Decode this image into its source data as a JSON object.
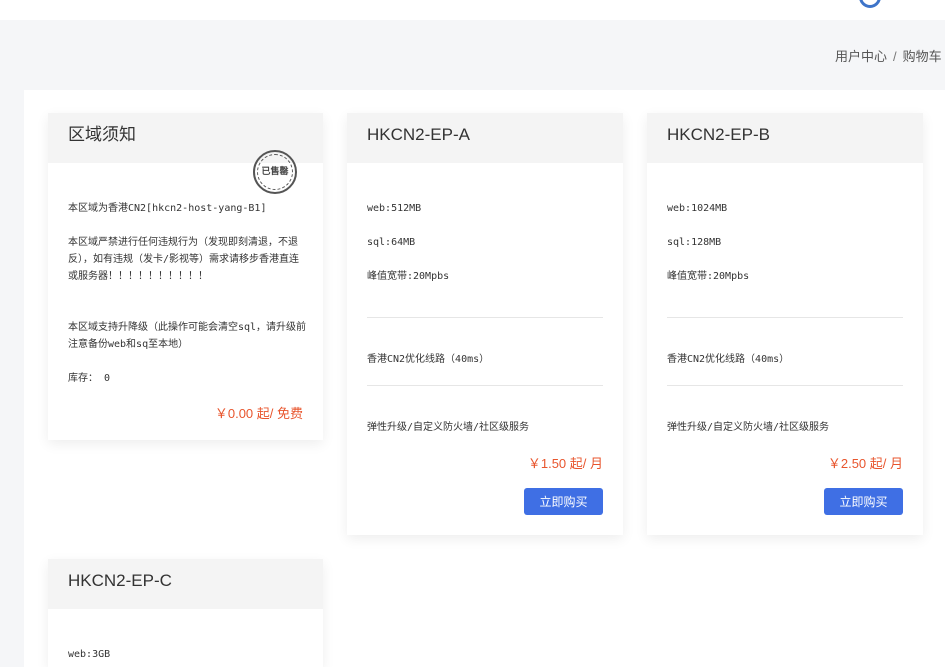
{
  "breadcrumb": {
    "home": "用户中心",
    "separator": "/",
    "current": "购物车"
  },
  "region_notice": {
    "title": "区域须知",
    "stamp": "已售罄",
    "paragraphs": [
      "本区域为香港CN2[hkcn2-host-yang-B1]",
      "本区域严禁进行任何违规行为（发现即刻清退，不退反），如有违规（发卡/影视等）需求请移步香港直连或服务器！！！！！！！！！！",
      "本区域支持升降级（此操作可能会清空sql，请升级前注意备份web和sq至本地）"
    ],
    "stock_label": "库存：",
    "stock_value": "0",
    "price": "￥0.00 起/ 免费"
  },
  "products": [
    {
      "name": "HKCN2-EP-A",
      "specs": [
        "web:512MB",
        "sql:64MB",
        "峰值宽带:20Mpbs"
      ],
      "route": "香港CN2优化线路（40ms）",
      "features": "弹性升级/自定义防火墙/社区级服务",
      "price": "￥1.50 起/ 月",
      "buy_label": "立即购买"
    },
    {
      "name": "HKCN2-EP-B",
      "specs": [
        "web:1024MB",
        "sql:128MB",
        "峰值宽带:20Mpbs"
      ],
      "route": "香港CN2优化线路（40ms）",
      "features": "弹性升级/自定义防火墙/社区级服务",
      "price": "￥2.50 起/ 月",
      "buy_label": "立即购买"
    },
    {
      "name": "HKCN2-EP-C",
      "specs": [
        "web:3GB"
      ]
    }
  ],
  "colors": {
    "accent": "#3f6fe4",
    "price": "#e8552d",
    "header_bg": "#f4f4f4"
  }
}
